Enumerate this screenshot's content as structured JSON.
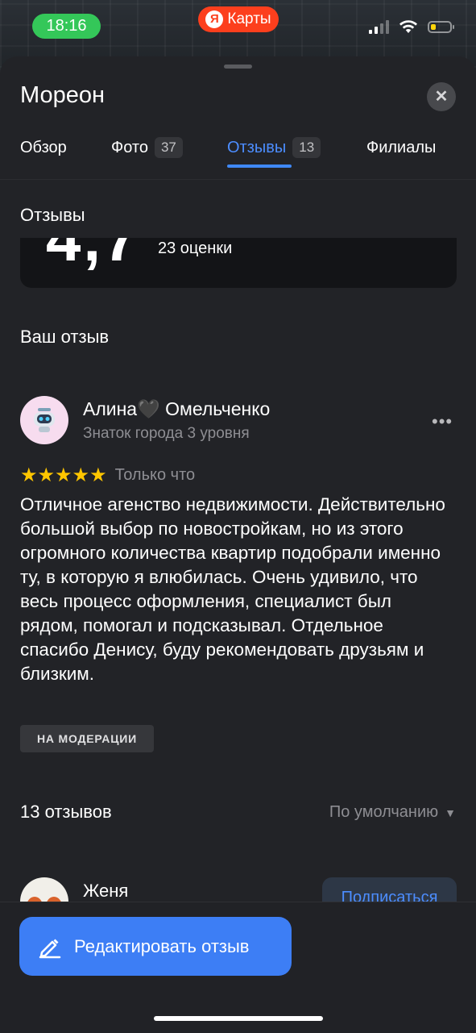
{
  "status_bar": {
    "time": "18:16",
    "app_name": "Карты",
    "app_logo_letter": "Я",
    "battery_level": 0.25,
    "battery_color": "#ffd60a",
    "time_pill_color": "#34c759"
  },
  "place": {
    "title": "Мореон",
    "close_icon": "close-icon"
  },
  "tabs": [
    {
      "label": "Обзор",
      "count": ""
    },
    {
      "label": "Фото",
      "count": "37"
    },
    {
      "label": "Отзывы",
      "count": "13",
      "active": true
    },
    {
      "label": "Филиалы",
      "count": ""
    }
  ],
  "reviews": {
    "section_title": "Отзывы",
    "rating": "4,7",
    "rating_count": "23 оценки",
    "your_review_title": "Ваш отзыв",
    "my_review": {
      "author": "Алина🖤 Омельченко",
      "level": "Знаток города 3 уровня",
      "stars": 5,
      "stars_text": "★★★★★",
      "time": "Только что",
      "text": "Отличное агенство недвижимости. Действительно большой выбор по новостройкам, но из этого огромного количества квартир подобрали именно ту, в которую я влюбилась. Очень удивило, что весь процесс оформления, специалист был рядом, помогал и подсказывал. Отдельное спасибо Денису, буду рекомендовать друзьям и близким.",
      "status_badge": "НА МОДЕРАЦИИ",
      "more_label": "•••"
    },
    "count_title": "13 отзывов",
    "sort_label": "По умолчанию",
    "next_review": {
      "author": "Женя",
      "subscribe_label": "Подписаться"
    }
  },
  "actions": {
    "edit_label": "Редактировать отзыв",
    "accent_color": "#3d7ef5"
  }
}
